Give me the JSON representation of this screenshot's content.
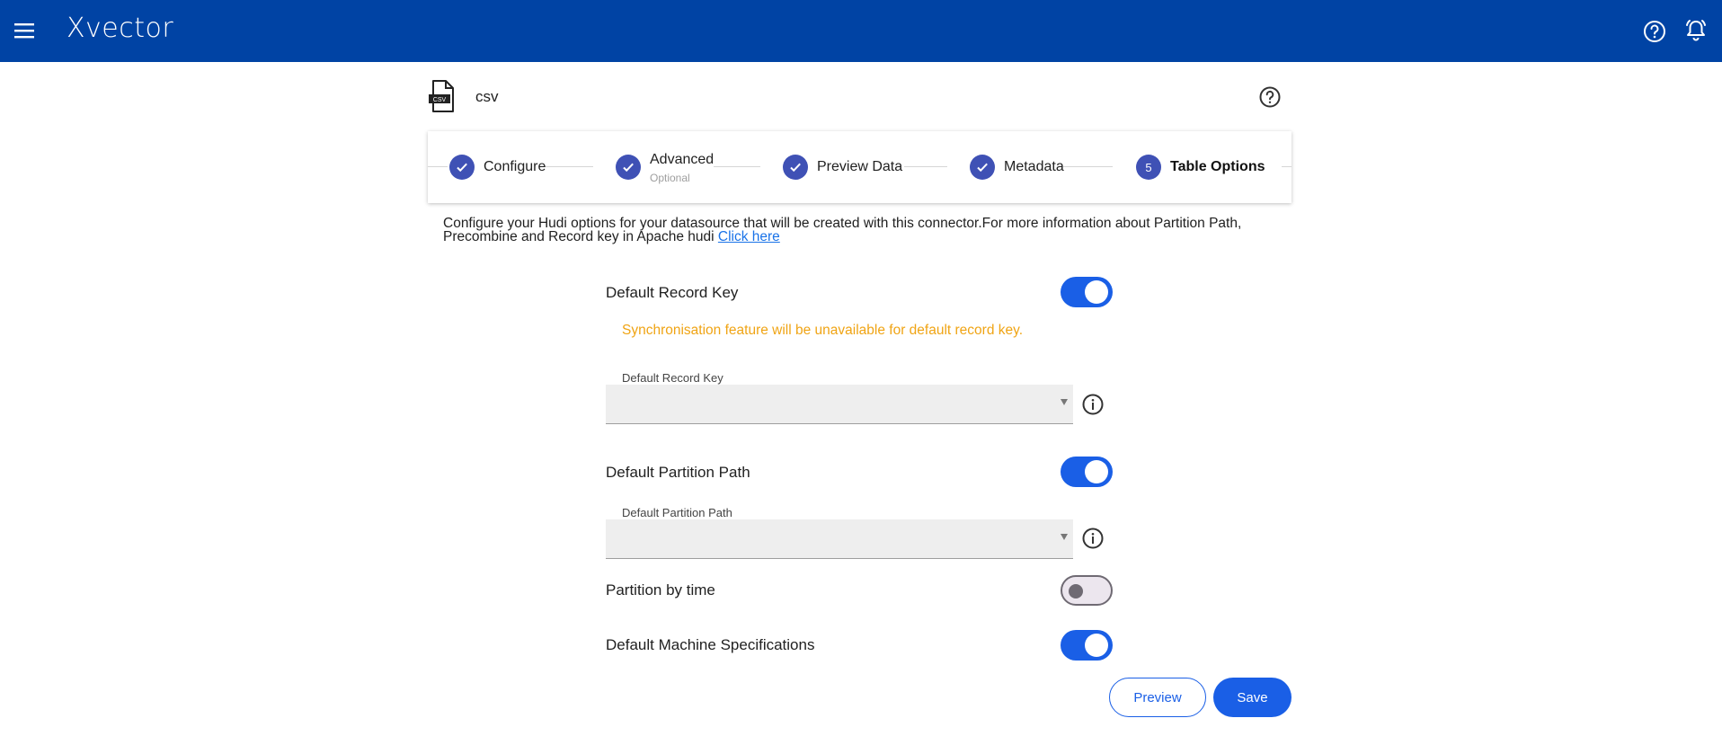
{
  "app": {
    "brand": "Xvector",
    "icons": {
      "menu": "menu-icon",
      "help": "help-icon",
      "notifications": "bell-icon"
    }
  },
  "source": {
    "title": "csv",
    "icon_badge": "CSV"
  },
  "stepper": {
    "steps": [
      {
        "label": "Configure",
        "sub": "",
        "state": "done"
      },
      {
        "label": "Advanced",
        "sub": "Optional",
        "state": "done"
      },
      {
        "label": "Preview Data",
        "sub": "",
        "state": "done"
      },
      {
        "label": "Metadata",
        "sub": "",
        "state": "done"
      },
      {
        "label": "Table Options",
        "sub": "",
        "state": "active",
        "number": "5"
      }
    ]
  },
  "intro": {
    "text": "Configure your Hudi options for your datasource that will be created with this connector.For more information about Partition Path, Precombine and Record key in Apache hudi ",
    "link": "Click here"
  },
  "options": {
    "default_record_key": {
      "label": "Default Record Key",
      "enabled": true
    },
    "warning": "Synchronisation feature will be unavailable for default record key.",
    "record_key_field": {
      "label": "Default Record Key",
      "value": ""
    },
    "default_partition_path": {
      "label": "Default Partition Path",
      "enabled": true
    },
    "partition_path_field": {
      "label": "Default Partition Path",
      "value": ""
    },
    "partition_by_time": {
      "label": "Partition by time",
      "enabled": false
    },
    "default_machine_specs": {
      "label": "Default Machine Specifications",
      "enabled": true
    }
  },
  "actions": {
    "preview": "Preview",
    "save": "Save"
  },
  "colors": {
    "appbar": "#0043a4",
    "step": "#3f51b5",
    "primary": "#1a5fe6",
    "warning": "#f0a414"
  }
}
